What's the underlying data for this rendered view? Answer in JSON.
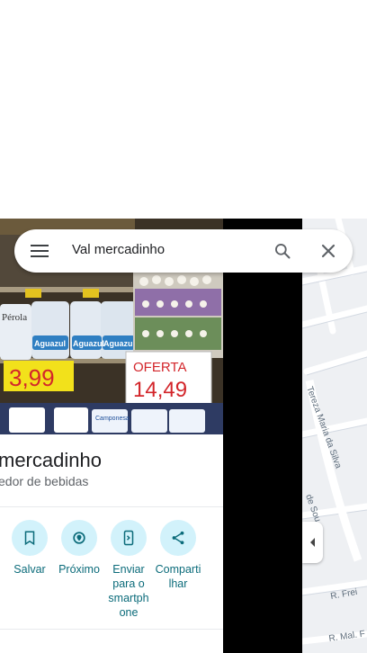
{
  "search": {
    "query": "Val mercadinho"
  },
  "place": {
    "title": "mercadinho",
    "subtitle": "edor de bebidas",
    "photo_texts": {
      "price_sign": "3,99",
      "offer_sign_title": "OFERTA",
      "offer_sign_price": "14,49",
      "bag_brand_1": "Pérola",
      "bag_brand_2": "Aguazul",
      "bag_brand_3": "Aguazul",
      "bag_brand_4": "Aguazul",
      "pack_brand": "Camponesa"
    }
  },
  "actions": [
    {
      "label": "Salvar",
      "icon": "bookmark-icon"
    },
    {
      "label": "Próximo",
      "icon": "nearby-icon"
    },
    {
      "label": "Enviar para o smartphone",
      "label_lines": [
        "Enviar",
        "para o",
        "smartph",
        "one"
      ],
      "icon": "send-to-phone-icon"
    },
    {
      "label": "Compartilhar",
      "label_lines": [
        "Comparti",
        "lhar"
      ],
      "icon": "share-icon"
    }
  ],
  "map": {
    "street_labels": [
      "Tereza Maria da Silva",
      "de Sou",
      "R. Frei",
      "R. Mal. F"
    ]
  },
  "colors": {
    "action_circle": "#d2f2fb",
    "action_text": "#0b6b7a",
    "map_road": "#c8d0da",
    "map_bg": "#eef0f3"
  }
}
